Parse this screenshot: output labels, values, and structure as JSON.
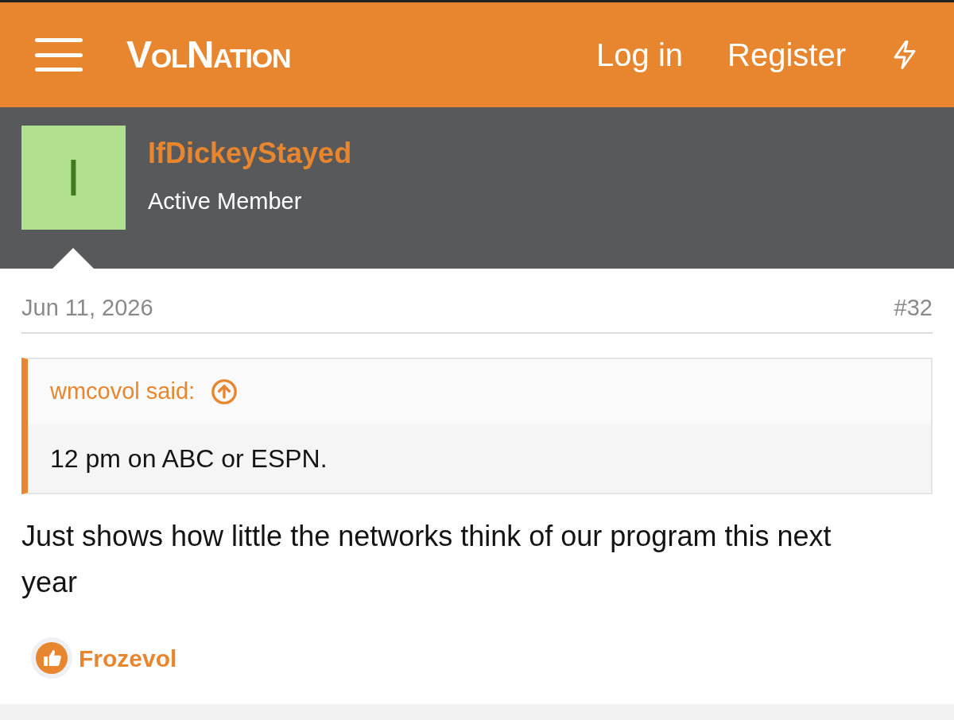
{
  "header": {
    "logo": "VolNation",
    "links": [
      "Log in",
      "Register"
    ]
  },
  "user": {
    "avatar_letter": "I",
    "name": "IfDickeyStayed",
    "title": "Active Member"
  },
  "post": {
    "date": "Jun 11, 2026",
    "number": "#32",
    "quote": {
      "author": "wmcovol said:",
      "text": "12 pm on ABC or ESPN."
    },
    "body": "Just shows how little the networks think of our program this next year",
    "reactions": [
      "Frozevol"
    ]
  }
}
